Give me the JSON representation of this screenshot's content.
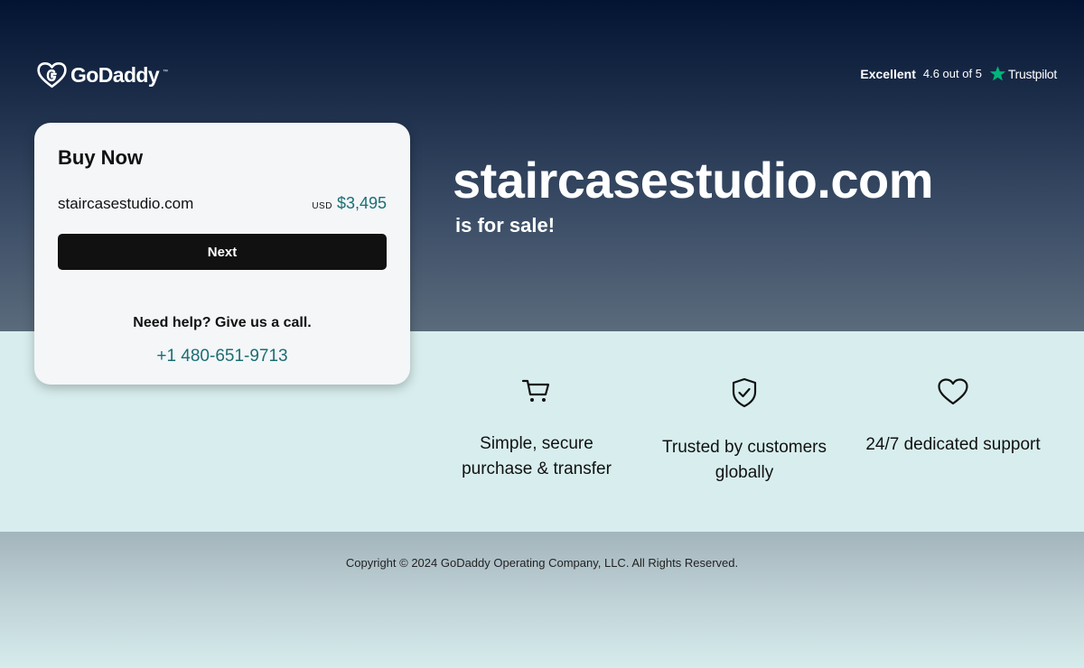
{
  "brand": {
    "name": "GoDaddy",
    "logo_icon": "godaddy-heart-icon"
  },
  "rating": {
    "label": "Excellent",
    "score": "4.6 out of 5",
    "provider": "Trustpilot",
    "icon": "trustpilot-star-icon",
    "star_color": "#00b67a"
  },
  "buy_card": {
    "title": "Buy Now",
    "domain": "staircasestudio.com",
    "currency": "USD",
    "price": "$3,495",
    "next_label": "Next",
    "help_text": "Need help? Give us a call.",
    "phone": "+1 480-651-9713"
  },
  "hero": {
    "domain": "staircasestudio.com",
    "subtitle": "is for sale!"
  },
  "features": [
    {
      "icon": "cart-icon",
      "line1": "Simple, secure",
      "line2": "purchase & transfer"
    },
    {
      "icon": "shield-check-icon",
      "line1": "Trusted by customers",
      "line2": "globally"
    },
    {
      "icon": "heart-icon",
      "line1": "24/7 dedicated support",
      "line2": ""
    }
  ],
  "footer": {
    "copyright": "Copyright © 2024 GoDaddy Operating Company, LLC. All Rights Reserved."
  },
  "colors": {
    "accent_teal": "#1b6e73",
    "button_bg": "#111111",
    "hero_top": "#021431",
    "features_bg": "#d8eeee"
  }
}
